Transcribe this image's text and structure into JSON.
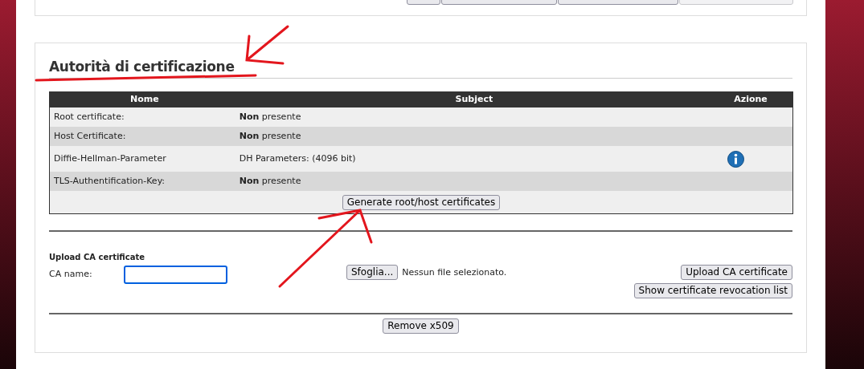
{
  "top_buttons": [
    {
      "disabled": false
    },
    {
      "disabled": false
    },
    {
      "disabled": false
    },
    {
      "disabled": true
    }
  ],
  "section": {
    "title": "Autorità di certificazione",
    "table": {
      "columns": [
        "Nome",
        "Subject",
        "Azione"
      ],
      "rows": [
        {
          "name": "Root certificate:",
          "subject": "**Non** presente",
          "info": false
        },
        {
          "name": "Host Certificate:",
          "subject": "**Non** presente",
          "info": false
        },
        {
          "name": "Diffie-Hellman-Parameter",
          "subject": "DH Parameters: (4096 bit)",
          "info": true
        },
        {
          "name": "TLS-Authentification-Key:",
          "subject": "**Non** presente",
          "info": false
        }
      ],
      "generate_button": "Generate root/host certificates"
    },
    "upload": {
      "title": "Upload CA certificate",
      "ca_name_label": "CA name:",
      "browse_button": "Sfoglia...",
      "file_status": "Nessun file selezionato.",
      "upload_button": "Upload CA certificate",
      "revocation_button": "Show certificate revocation list"
    },
    "remove_button": "Remove x509"
  }
}
